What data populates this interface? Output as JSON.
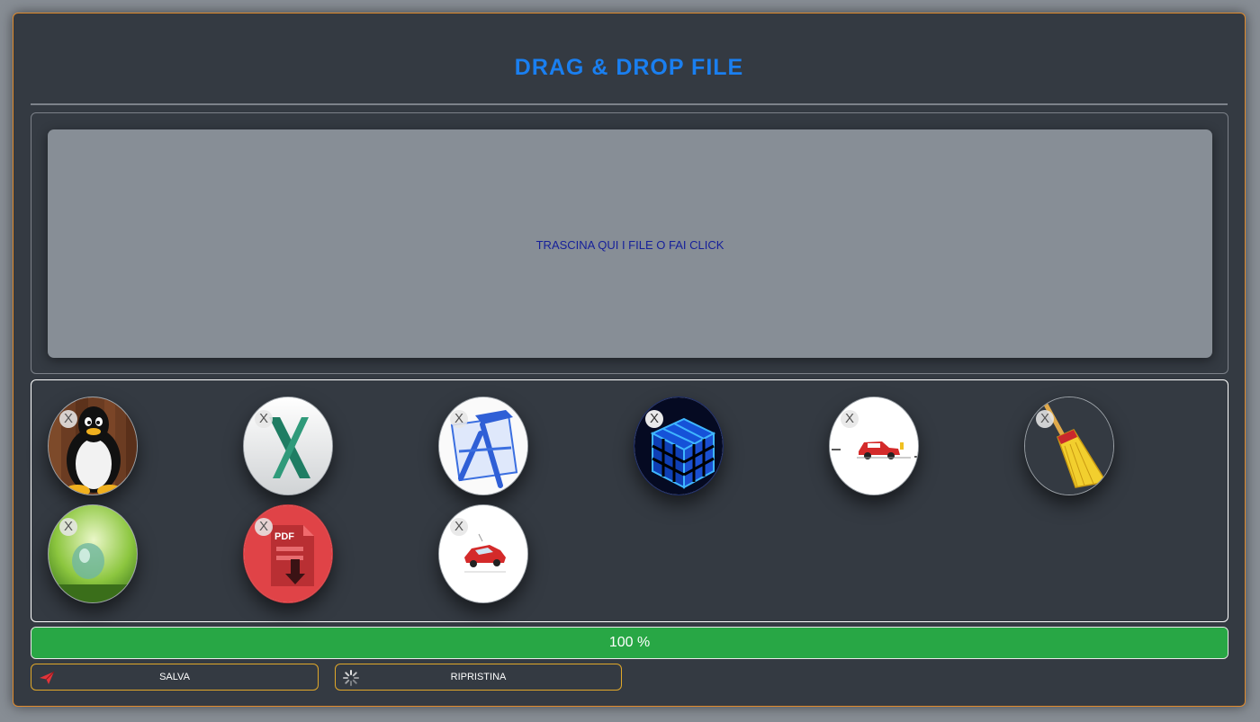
{
  "header": {
    "title": "DRAG & DROP FILE"
  },
  "dropzone": {
    "label": "TRASCINA QUI I FILE O FAI CLICK"
  },
  "files": [
    {
      "name": "linux-tux-thumbnail",
      "remove_label": "X"
    },
    {
      "name": "macos-x-thumbnail",
      "remove_label": "X"
    },
    {
      "name": "xcode-tools-thumbnail",
      "remove_label": "X"
    },
    {
      "name": "blue-cube-thumbnail",
      "remove_label": "X"
    },
    {
      "name": "red-car-road-thumbnail",
      "remove_label": "X"
    },
    {
      "name": "broom-thumbnail",
      "remove_label": "X"
    },
    {
      "name": "water-drop-thumbnail",
      "remove_label": "X"
    },
    {
      "name": "pdf-download-thumbnail",
      "remove_label": "X"
    },
    {
      "name": "red-car-crash-thumbnail",
      "remove_label": "X"
    }
  ],
  "progress": {
    "value": 100,
    "label": "100 %"
  },
  "actions": {
    "save_label": "SALVA",
    "save_icon": "paper-plane-icon",
    "reset_label": "RIPRISTINA",
    "reset_icon": "spinner-icon"
  },
  "colors": {
    "title": "#1a7ff0",
    "panel_border": "#e08a2c",
    "progress": "#28a745",
    "button_border": "#e0a82a",
    "dropzone_text": "#16209a"
  }
}
